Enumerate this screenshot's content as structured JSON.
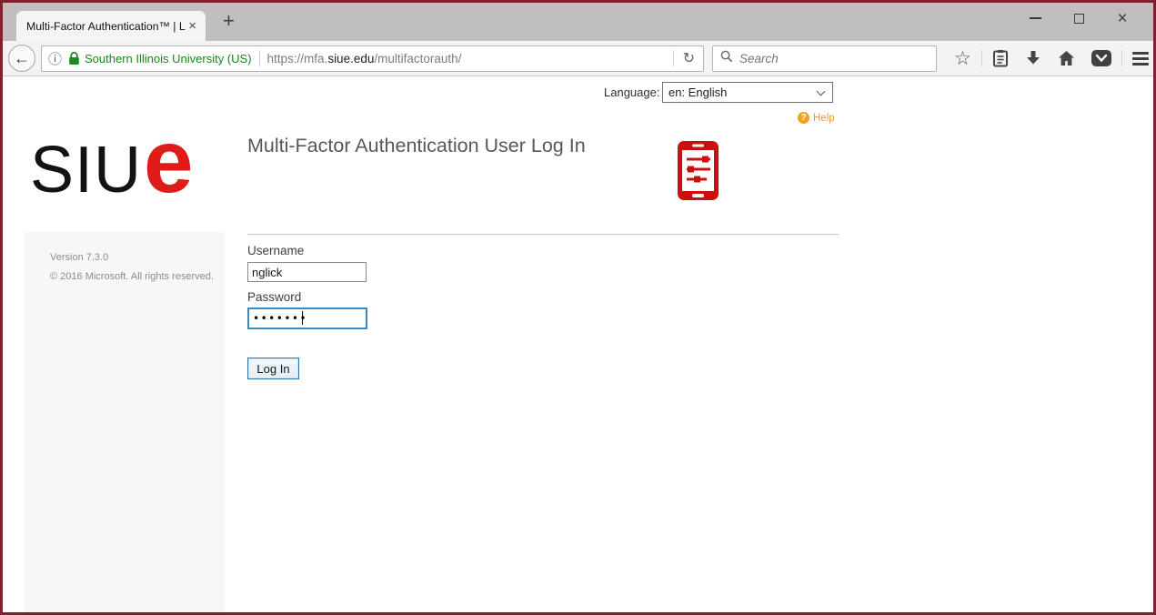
{
  "browser": {
    "tab": {
      "title": "Multi-Factor Authentication™ | L"
    },
    "identity": {
      "site": "Southern Illinois University (US)"
    },
    "url": {
      "prefix": "https://mfa.",
      "domain": "siue.edu",
      "path": "/multifactorauth/"
    },
    "search": {
      "placeholder": "Search"
    }
  },
  "page": {
    "language": {
      "label": "Language:",
      "selected": "en: English"
    },
    "help": {
      "label": "Help",
      "badge": "?"
    },
    "logo": {
      "black": "SIU",
      "red": "e"
    },
    "title": "Multi-Factor Authentication User Log In",
    "sidebar": {
      "version": "Version 7.3.0",
      "copyright": "© 2016 Microsoft. All rights reserved."
    },
    "form": {
      "username_label": "Username",
      "username_value": "nglick",
      "password_label": "Password",
      "password_value": "•••••••",
      "login_label": "Log In"
    }
  },
  "icons": {
    "new_tab": "+",
    "tab_close": "×",
    "window_close": "×",
    "back": "←",
    "info": "ⓘ",
    "reload": "↻",
    "star": "☆",
    "window_minimize": "css-bar",
    "window_maximize": "css-box",
    "lock": "svg-green-padlock",
    "search_magnifier": "svg",
    "bookmarks_clipboard": "svg",
    "download_arrow": "svg",
    "home": "svg",
    "pocket": "svg-chevron-badge",
    "menu": "css-hamburger",
    "select_chevron": "css-chevron",
    "phone_settings": "svg-red-phone-sliders"
  },
  "colors": {
    "window_border_maroon": "#7b2230",
    "tabbar_bg": "#c1bebe",
    "toolbar_bg": "#f4f2f2",
    "identity_green": "#178717",
    "logo_red": "#e01c18",
    "phone_red": "#cc0f0f",
    "help_orange": "#e89a3c",
    "focus_blue": "#3d89c4",
    "sidebar_bg": "#f7f7f7",
    "heading_gray": "#575757"
  }
}
